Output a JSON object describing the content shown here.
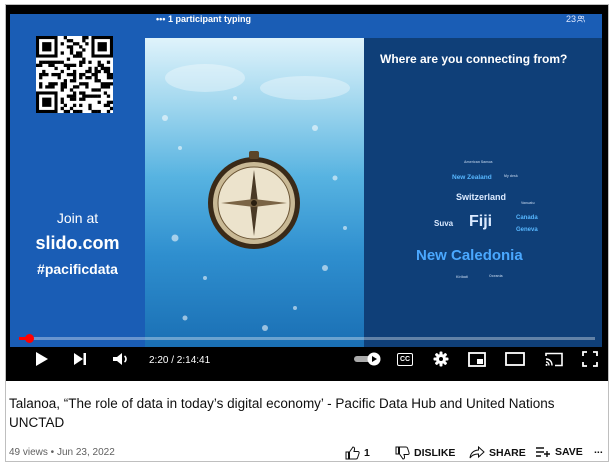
{
  "player": {
    "typing_text": "••• 1 participant typing",
    "participant_count": "23",
    "join_at": "Join at",
    "join_site": "slido.com",
    "join_hashtag": "#pacificdata",
    "question": "Where are you connecting from?",
    "word_cloud": [
      {
        "text": "American Samoa",
        "size": 3.5,
        "color": "#9fb8d6"
      },
      {
        "text": "New Zealand",
        "size": 6.5,
        "color": "#57b7ff"
      },
      {
        "text": "My desk",
        "size": 3.5,
        "color": "#9fb8d6"
      },
      {
        "text": "Switzerland",
        "size": 9,
        "color": "#dbeaff"
      },
      {
        "text": "Vanuatu",
        "size": 3.5,
        "color": "#9fb8d6"
      },
      {
        "text": "Suva",
        "size": 8,
        "color": "#dbeaff"
      },
      {
        "text": "Fiji",
        "size": 16,
        "color": "#dbeaff"
      },
      {
        "text": "Canada",
        "size": 6,
        "color": "#57b7ff"
      },
      {
        "text": "Geneva",
        "size": 6,
        "color": "#57b7ff"
      },
      {
        "text": "New Caledonia",
        "size": 15,
        "color": "#4aa8ff"
      },
      {
        "text": "Kiribati",
        "size": 3.5,
        "color": "#9fb8d6"
      },
      {
        "text": "Oceania",
        "size": 3.5,
        "color": "#9fb8d6"
      }
    ],
    "time_display": "2:20 / 2:14:41",
    "progress_fraction": 0.0174,
    "controls": {
      "play": "play-icon",
      "next": "next-icon",
      "volume": "volume-icon",
      "autoplay": "autoplay-toggle-icon",
      "captions_label": "CC",
      "settings": "gear-icon",
      "miniplayer": "miniplayer-icon",
      "theater": "theater-icon",
      "cast": "cast-icon",
      "fullscreen": "fullscreen-icon"
    }
  },
  "video": {
    "title": "Talanoa, “The role of data in today’s digital economy’ - Pacific Data Hub and United Nations UNCTAD",
    "meta": "49 views • Jun 23, 2022",
    "like_count": "1",
    "dislike_label": "DISLIKE",
    "share_label": "SHARE",
    "save_label": "SAVE",
    "more": "..."
  }
}
